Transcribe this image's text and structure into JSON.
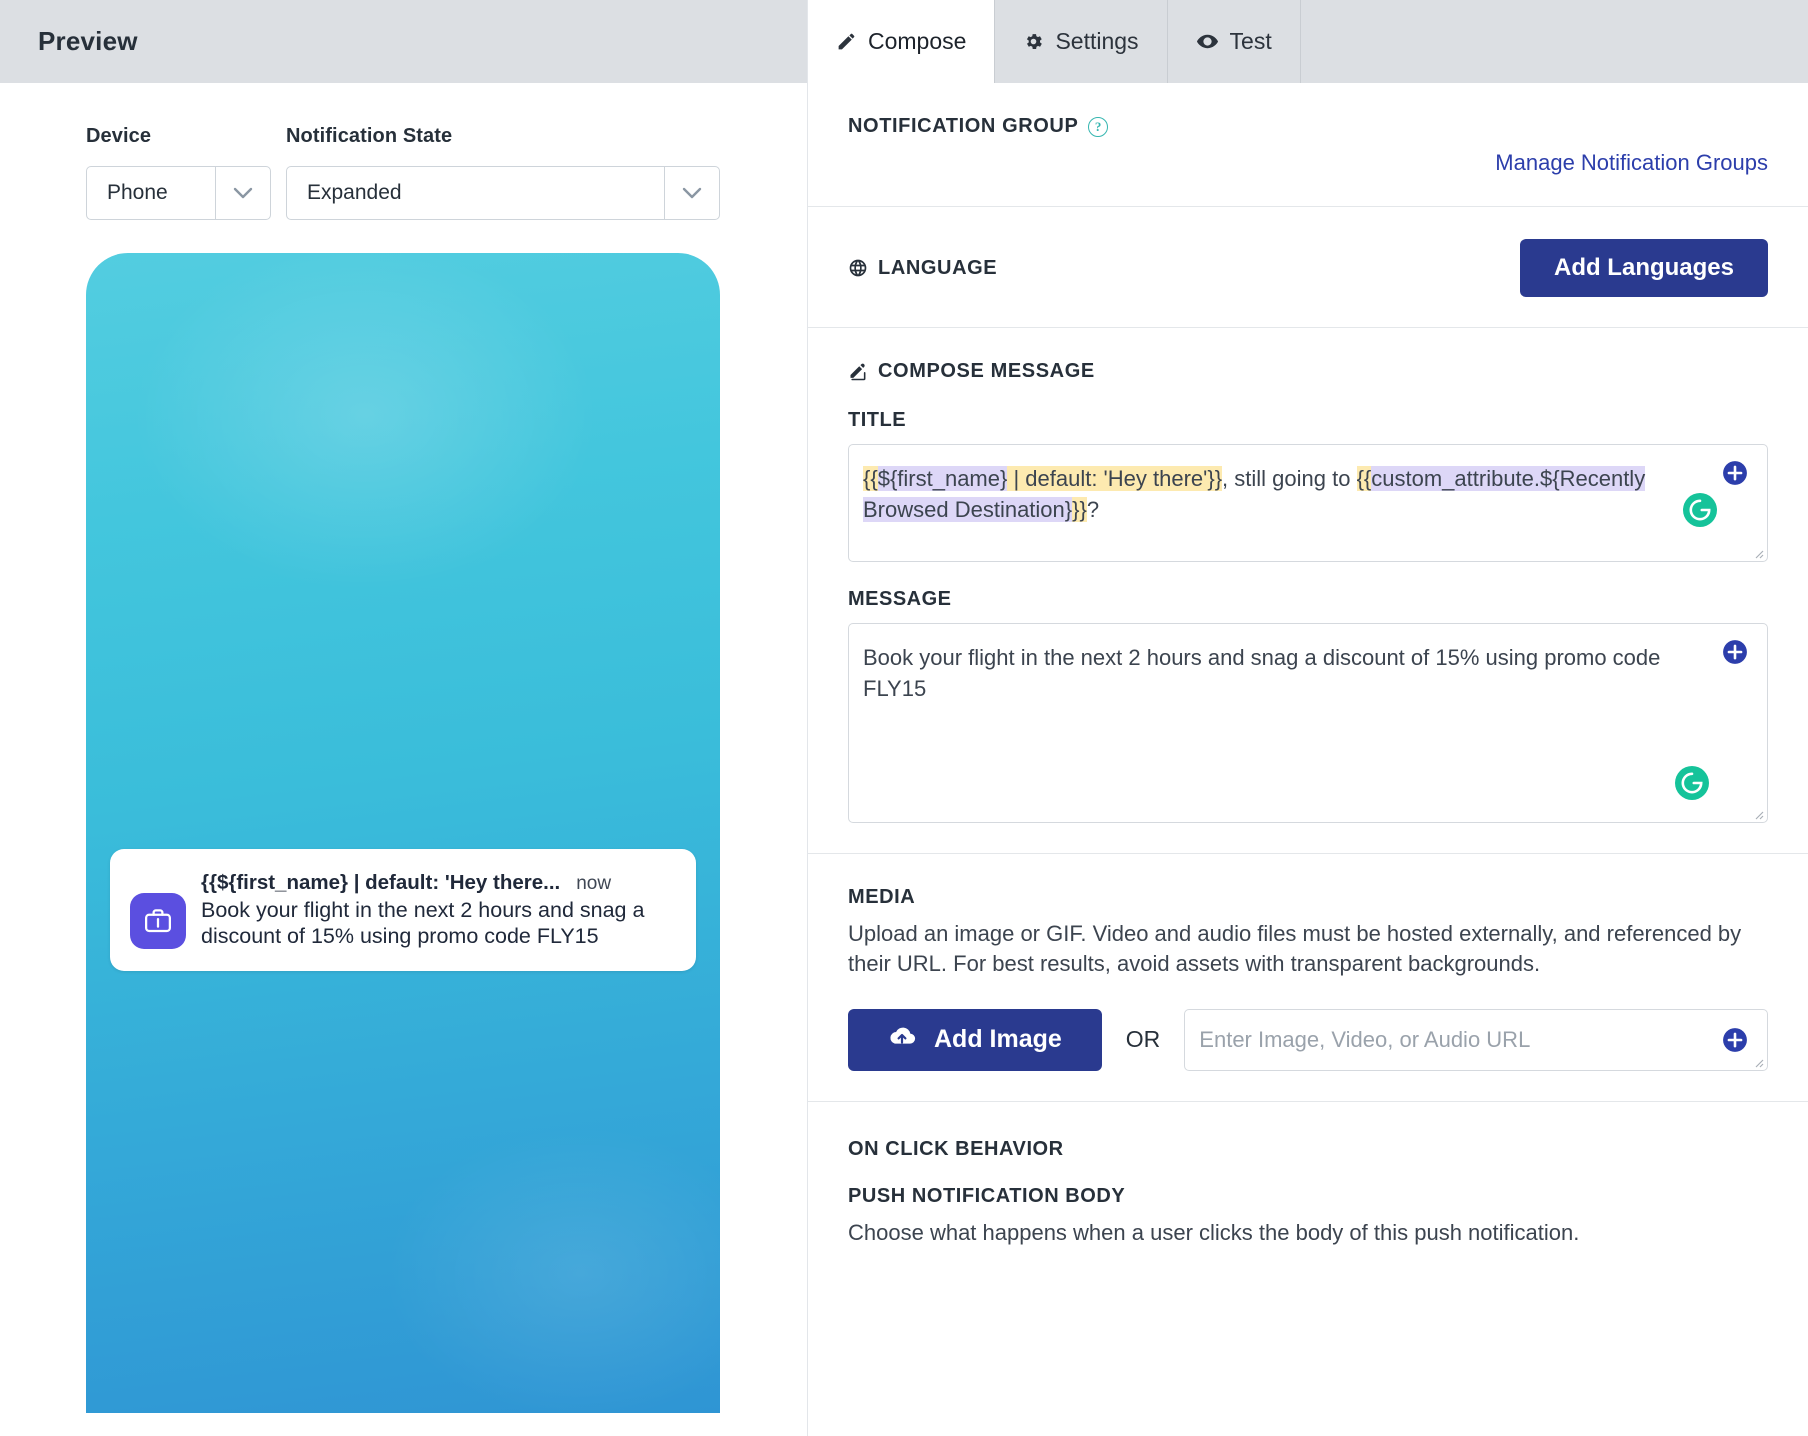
{
  "preview": {
    "header_title": "Preview",
    "device_label": "Device",
    "device_value": "Phone",
    "state_label": "Notification State",
    "state_value": "Expanded",
    "notification": {
      "title": "{{${first_name} | default: 'Hey there...",
      "time": "now",
      "body": "Book your flight in the next 2 hours and snag a discount of 15% using promo code FLY15",
      "icon": "briefcase-icon"
    }
  },
  "tabs": [
    {
      "label": "Compose",
      "icon": "pencil-icon",
      "active": true
    },
    {
      "label": "Settings",
      "icon": "gear-icon",
      "active": false
    },
    {
      "label": "Test",
      "icon": "eye-icon",
      "active": false
    }
  ],
  "notification_group": {
    "heading": "NOTIFICATION GROUP",
    "help_icon": "question-mark-icon",
    "manage_link": "Manage Notification Groups"
  },
  "language": {
    "heading": "LANGUAGE",
    "icon": "globe-icon",
    "add_button": "Add Languages"
  },
  "compose": {
    "heading": "COMPOSE MESSAGE",
    "icon": "compose-pencil-icon",
    "title_label": "TITLE",
    "title_segments": [
      {
        "text": "{{",
        "hl": "yellow"
      },
      {
        "text": "${first_name}",
        "hl": "purple"
      },
      {
        "text": " | default: 'Hey there'}}",
        "hl": "yellow"
      },
      {
        "text": ", still going to ",
        "hl": "none"
      },
      {
        "text": "{{",
        "hl": "yellow"
      },
      {
        "text": "custom_attribute.${Recently Browsed Destination}",
        "hl": "purple"
      },
      {
        "text": "}}",
        "hl": "yellow"
      },
      {
        "text": "?",
        "hl": "none"
      }
    ],
    "message_label": "MESSAGE",
    "message_value": "Book your flight in the next 2 hours and snag a discount of 15% using promo code FLY15",
    "add_icon": "plus-circle-icon",
    "grammarly_icon": "grammarly-icon"
  },
  "media": {
    "heading": "MEDIA",
    "description": "Upload an image or GIF. Video and audio files must be hosted externally, and referenced by their URL. For best results, avoid assets with transparent backgrounds.",
    "add_image_button": "Add Image",
    "upload_icon": "cloud-upload-icon",
    "or_text": "OR",
    "url_placeholder": "Enter Image, Video, or Audio URL",
    "url_value": "",
    "add_icon": "plus-circle-icon"
  },
  "on_click": {
    "heading": "ON CLICK BEHAVIOR",
    "push_body_heading": "PUSH NOTIFICATION BODY",
    "push_body_desc": "Choose what happens when a user clicks the body of this push notification."
  },
  "colors": {
    "primary_blue": "#2a3a8f",
    "link_blue": "#2c3eab",
    "teal_accent": "#36b6b0",
    "grammarly_green": "#15c39a",
    "highlight_yellow": "#fdeab0",
    "highlight_purple": "#ddd7f7",
    "icon_purple": "#5b4fe0"
  }
}
